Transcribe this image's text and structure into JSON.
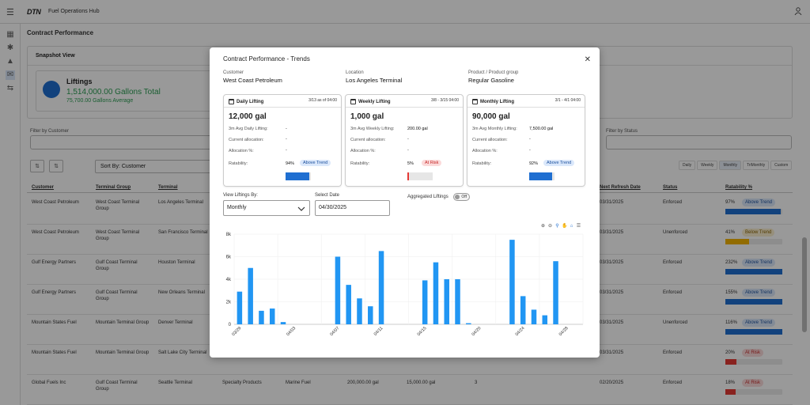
{
  "app": {
    "logo": "DTN",
    "title": "Fuel Operations Hub",
    "page_title": "Contract Performance"
  },
  "snapshot": {
    "header": "Snapshot View",
    "liftings_label": "Liftings",
    "total": "1,514,000.00 Gallons Total",
    "average": "75,700.00 Gallons Average"
  },
  "filters": {
    "customer_label": "Filter by Customer",
    "status_label": "Filter by Status",
    "sort_label": "Sort By: Customer",
    "periods": [
      "Daily",
      "Weekly",
      "Monthly",
      "TriMonthly",
      "Custom"
    ]
  },
  "table": {
    "headers": [
      "Customer",
      "Terminal Group",
      "Terminal",
      "Next Refresh Date",
      "Status",
      "Ratability %"
    ],
    "rows": [
      {
        "customer": "West Coast Petroleum",
        "group": "West Coast Terminal Group",
        "terminal": "Los Angeles Terminal",
        "refresh": "03/31/2025",
        "status": "Enforced",
        "pct": "97%",
        "badge": "Above Trend",
        "badge_type": "above",
        "fill": 0.97
      },
      {
        "customer": "West Coast Petroleum",
        "group": "West Coast Terminal Group",
        "terminal": "San Francisco Terminal",
        "refresh": "03/31/2025",
        "status": "Unenforced",
        "pct": "41%",
        "badge": "Below Trend",
        "badge_type": "below",
        "fill": 0.41
      },
      {
        "customer": "Gulf Energy Partners",
        "group": "Gulf Coast Terminal Group",
        "terminal": "Houston Terminal",
        "refresh": "03/31/2025",
        "status": "Enforced",
        "pct": "232%",
        "badge": "Above Trend",
        "badge_type": "above",
        "fill": 1.0
      },
      {
        "customer": "Gulf Energy Partners",
        "group": "Gulf Coast Terminal Group",
        "terminal": "New Orleans Terminal",
        "refresh": "03/31/2025",
        "status": "Enforced",
        "pct": "155%",
        "badge": "Above Trend",
        "badge_type": "above",
        "fill": 1.0
      },
      {
        "customer": "Mountain States Fuel",
        "group": "Mountain Terminal Group",
        "terminal": "Denver Terminal",
        "refresh": "03/31/2025",
        "status": "Unenforced",
        "pct": "116%",
        "badge": "Above Trend",
        "badge_type": "above",
        "fill": 1.0
      },
      {
        "customer": "Mountain States Fuel",
        "group": "Mountain Terminal Group",
        "terminal": "Salt Lake City Terminal",
        "refresh": "03/31/2025",
        "status": "Enforced",
        "pct": "20%",
        "badge": "At Risk",
        "badge_type": "risk",
        "fill": 0.2
      },
      {
        "customer": "Global Fuels Inc",
        "group": "Gulf Coast Terminal Group",
        "terminal": "Seattle Terminal",
        "refresh": "02/20/2025",
        "status": "Enforced",
        "pct": "18%",
        "badge": "At Risk",
        "badge_type": "risk",
        "fill": 0.18
      }
    ],
    "extra_last_row": [
      "Specialty Products",
      "Marine Fuel",
      "200,000.00 gal",
      "15,000.00 gal",
      "3"
    ]
  },
  "modal": {
    "title": "Contract Performance - Trends",
    "customer_label": "Customer",
    "customer": "West Coast Petroleum",
    "location_label": "Location",
    "location": "Los Angeles Terminal",
    "product_label": "Product / Product group",
    "product": "Regular Gasoline",
    "cards": [
      {
        "title": "Daily Lifting",
        "date": "3/13 as of 04:00",
        "amount": "12,000 gal",
        "avg_label": "3m Avg Daily Lifting:",
        "avg": "-",
        "alloc_label": "Current allocation:",
        "alloc": "-",
        "pct_label": "Allocation %:",
        "pct": "-",
        "rat_label": "Ratability:",
        "rat": "94%",
        "badge": "Above Trend",
        "badge_type": "above",
        "fill": 0.94
      },
      {
        "title": "Weekly Lifting",
        "date": "3/8 - 3/15 04:00",
        "amount": "1,000 gal",
        "avg_label": "3m Avg Weekly Lifting:",
        "avg": "200.00 gal",
        "alloc_label": "Current allocation:",
        "alloc": "-",
        "pct_label": "Allocation %:",
        "pct": "-",
        "rat_label": "Ratability:",
        "rat": "5%",
        "badge": "At Risk",
        "badge_type": "risk",
        "fill": 0.05
      },
      {
        "title": "Monthly Lifting",
        "date": "3/1 - 4/1 04:00",
        "amount": "90,000 gal",
        "avg_label": "3m Avg Monthly Lifting:",
        "avg": "7,500.00 gal",
        "alloc_label": "Current allocation:",
        "alloc": "-",
        "pct_label": "Allocation %:",
        "pct": "-",
        "rat_label": "Ratability:",
        "rat": "92%",
        "badge": "Above Trend",
        "badge_type": "above",
        "fill": 0.92
      }
    ],
    "view_label": "View Liftings By:",
    "view_value": "Monthly",
    "date_label": "Select Date",
    "date_value": "04/30/2025",
    "aggregated_label": "Aggregated Liftings",
    "toggle_state": "Off"
  },
  "colors": {
    "accent": "#1f6fd1",
    "bar": "#2196f3",
    "above_bg": "#dbe8fb",
    "above_fg": "#1a4f9c",
    "risk_bg": "#fbdada",
    "risk_fg": "#c62828",
    "below_bg": "#fbefcf",
    "below_fg": "#8a6300"
  },
  "chart_data": {
    "type": "bar",
    "x": [
      "03/29",
      "03/30",
      "03/31",
      "04/01",
      "04/02",
      "04/03",
      "04/04",
      "04/05",
      "04/06",
      "04/07",
      "04/08",
      "04/09",
      "04/10",
      "04/11",
      "04/12",
      "04/13",
      "04/14",
      "04/15",
      "04/16",
      "04/17",
      "04/18",
      "04/19",
      "04/20",
      "04/21",
      "04/22",
      "04/23",
      "04/24",
      "04/25",
      "04/26",
      "04/27",
      "04/28",
      "04/29"
    ],
    "values": [
      2900,
      5000,
      1200,
      1400,
      200,
      0,
      0,
      0,
      0,
      6000,
      3500,
      2300,
      1600,
      6500,
      0,
      0,
      0,
      3900,
      5500,
      4000,
      4000,
      100,
      0,
      0,
      0,
      7500,
      2500,
      1300,
      800,
      5600,
      0,
      0
    ],
    "tick_labels": [
      "03/29",
      "04/03",
      "04/07",
      "04/11",
      "04/15",
      "04/20",
      "04/24",
      "04/28"
    ],
    "y_ticks": [
      "0",
      "2k",
      "4k",
      "6k",
      "8k"
    ],
    "ylim": [
      0,
      8000
    ]
  }
}
